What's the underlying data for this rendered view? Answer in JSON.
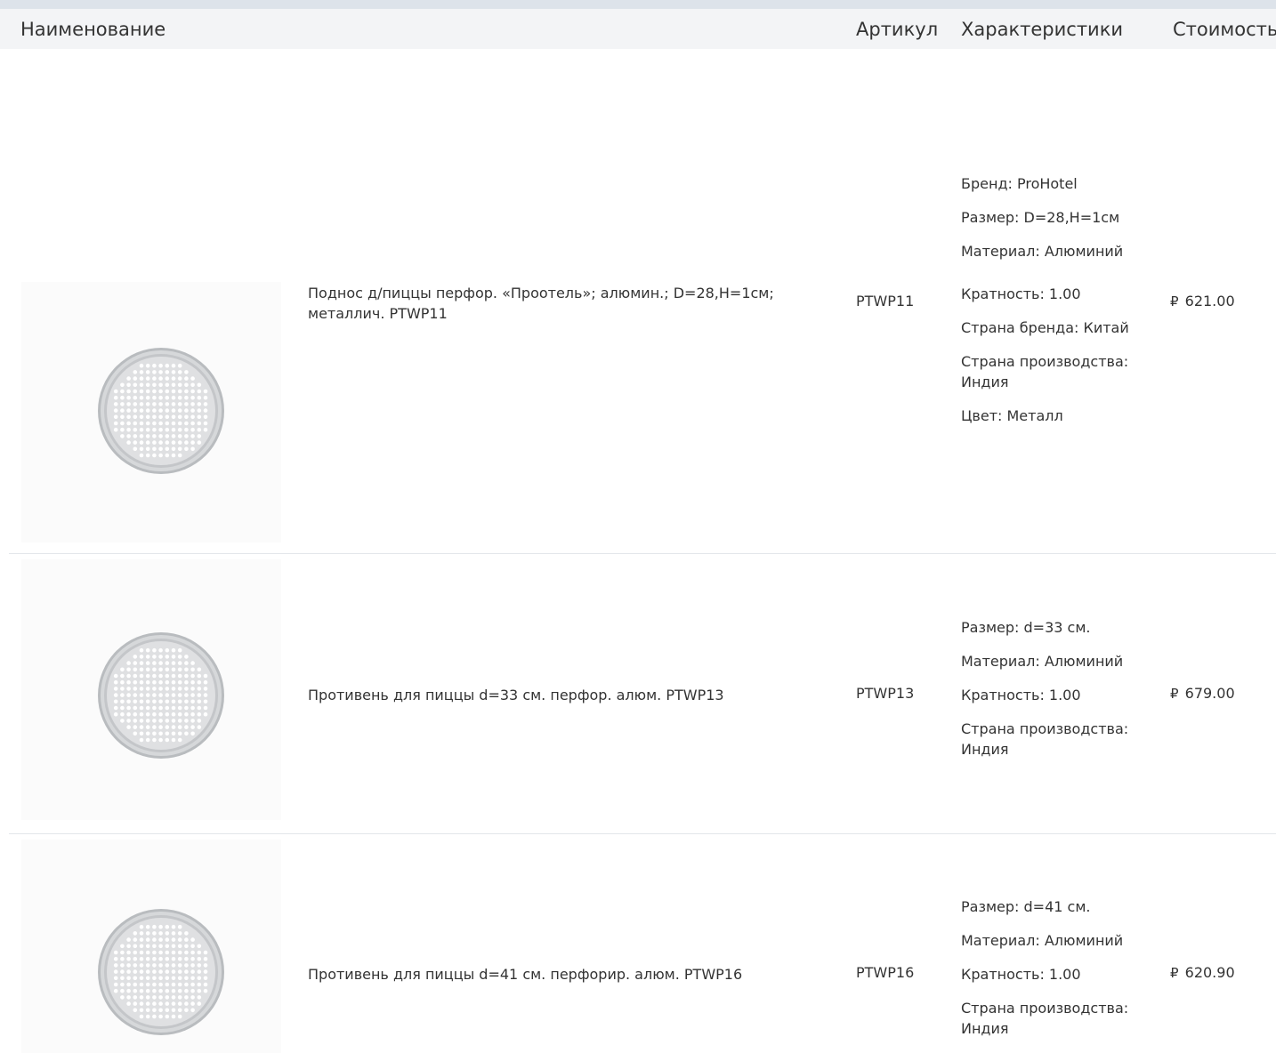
{
  "table": {
    "headers": {
      "name": "Наименование",
      "article": "Артикул",
      "specs": "Характеристики",
      "price": "Стоимость"
    },
    "rows": [
      {
        "name": "Поднос д/пиццы перфор. «Проотель»; алюмин.; D=28,H=1см; металлич. PTWP11",
        "article": "PTWP11",
        "specs": [
          "Бренд: ProHotel",
          "Размер: D=28,H=1см",
          "Материал: Алюминий",
          "Кратность: 1.00",
          "Страна бренда: Китай",
          "Страна производства: Индия",
          "Цвет: Металл"
        ],
        "currency": "₽",
        "price": "621.00"
      },
      {
        "name": "Противень для пиццы d=33 см. перфор. алюм. PTWP13",
        "article": "PTWP13",
        "specs": [
          "Размер: d=33 см.",
          "Материал: Алюминий",
          "Кратность: 1.00",
          "Страна производства: Индия"
        ],
        "currency": "₽",
        "price": "679.00"
      },
      {
        "name": "Противень для пиццы d=41 см. перфорир. алюм. PTWP16",
        "article": "PTWP16",
        "specs": [
          "Размер: d=41 см.",
          "Материал: Алюминий",
          "Кратность: 1.00",
          "Страна производства: Индия"
        ],
        "currency": "₽",
        "price": "620.90"
      }
    ]
  },
  "colors": {
    "header_bg": "#f3f4f6",
    "top_bar": "#dde3ea",
    "row_divider": "#e3e6ea",
    "text": "#333333",
    "pan_rim": "#b9bcbf"
  },
  "icons": {
    "product_image": "perforated-pizza-pan"
  }
}
